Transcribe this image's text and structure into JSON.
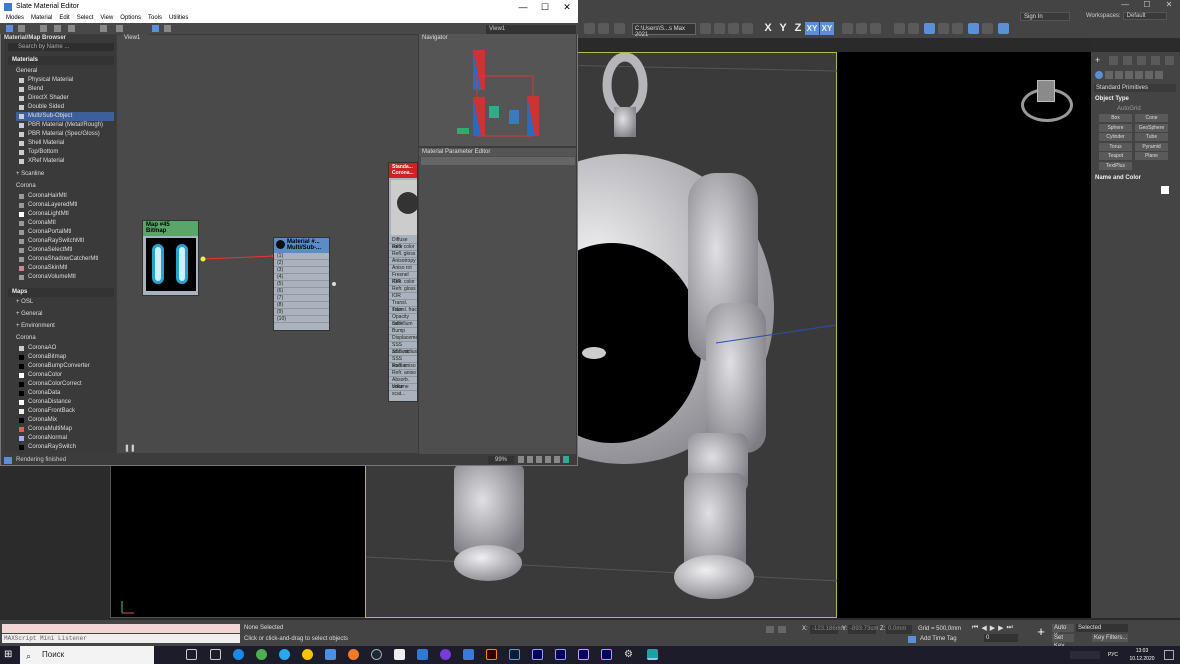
{
  "max": {
    "signin": "Sign In",
    "workspaces_label": "Workspaces:",
    "workspaces_value": "Default",
    "path": "C:\\Users\\S...s Max 2021",
    "axes": [
      "X",
      "Y",
      "Z",
      "XY",
      "XY"
    ],
    "command_panel": {
      "dropdown": "Standard Primitives",
      "object_type": "Object Type",
      "autogrid": "AutoGrid",
      "buttons": [
        "Box",
        "Cone",
        "Sphere",
        "GeoSphere",
        "Cylinder",
        "Tube",
        "Torus",
        "Pyramid",
        "Teapot",
        "Plane",
        "TextPlus"
      ],
      "name_and_color": "Name and Color"
    },
    "status": {
      "none_selected": "None Selected",
      "hint": "Click or click-and-drag to select objects",
      "x_label": "X:",
      "x_val": "-123.186mm",
      "y_label": "Y:",
      "y_val": "-893.73cm",
      "z_label": "Z:",
      "z_val": "0.0mm",
      "grid": "Grid = 500,0mm",
      "add_time_tag": "Add Time Tag",
      "auto_key": "Auto K...",
      "set_key": "Set Key",
      "selected": "Selected",
      "key_filters": "Key Filters...",
      "frame": "0"
    },
    "maxscript": "",
    "maxscript_listener": "MAXScript Mini Listener"
  },
  "slate": {
    "title": "Slate Material Editor",
    "menus": [
      "Modes",
      "Material",
      "Edit",
      "Select",
      "View",
      "Options",
      "Tools",
      "Utilities"
    ],
    "view_tab": "View1",
    "view_dropdown": "View1",
    "browser_title": "Material/Map Browser",
    "search_placeholder": "Search by Name ...",
    "sections": {
      "materials": "Materials",
      "general": "General",
      "scanline": "+ Scanline",
      "corona": "Corona",
      "maps": "Maps",
      "osl": "+ OSL",
      "maps_general": "+ General",
      "environment": "+ Environment",
      "maps_corona": "Corona"
    },
    "general_items": [
      "Physical Material",
      "Blend",
      "DirectX Shader",
      "Double Sided",
      "Multi/Sub-Object",
      "PBR Material (Metal/Rough)",
      "PBR Material (Spec/Gloss)",
      "Shell Material",
      "Top/Bottom",
      "XRef Material"
    ],
    "corona_items": [
      "CoronaHairMtl",
      "CoronaLayeredMtl",
      "CoronaLightMtl",
      "CoronaMtl",
      "CoronaPortalMtl",
      "CoronaRaySwitchMtl",
      "CoronaSelectMtl",
      "CoronaShadowCatcherMtl",
      "CoronaSkinMtl",
      "CoronaVolumeMtl"
    ],
    "map_items": [
      "CoronaAO",
      "CoronaBitmap",
      "CoronaBumpConverter",
      "CoronaColor",
      "CoronaColorCorrect",
      "CoronaData",
      "CoronaDistance",
      "CoronaFrontBack",
      "CoronaMix",
      "CoronaMultiMap",
      "CoronaNormal",
      "CoronaRaySwitch"
    ],
    "navigator": "Navigator",
    "param_editor": "Material Parameter Editor",
    "node_bitmap": {
      "line1": "Map #45",
      "line2": "Bitmap"
    },
    "node_multi": {
      "line1": "Material #...",
      "line2": "Multi/Sub-...",
      "slots": [
        "(1)",
        "(2)",
        "(3)",
        "(4)",
        "(5)",
        "(6)",
        "(7)",
        "(8)",
        "(9)",
        "(10)"
      ]
    },
    "node_corona": {
      "line1": "Standa...",
      "line2": "Corona...",
      "slots": [
        "Diffuse color",
        "Refl. color",
        "Refl. gloss",
        "Anisotropy",
        "Aniso rot",
        "Fresnel IOR",
        "Refr. color",
        "Refr. gloss",
        "IOR",
        "Transl. color",
        "Transl. frac",
        "Opacity color",
        "Self-illum",
        "Bump",
        "Displacement",
        "SSS amount",
        "SSS radius",
        "SSS scatter",
        "Refl. aniso",
        "Refr. aniso",
        "Absorb. color",
        "Volume scat..."
      ]
    },
    "status": "Rendering finished",
    "zoom": "99%"
  },
  "taskbar": {
    "search": "Поиск",
    "lang": "РУС",
    "time": "13:03",
    "date": "10.12.2020"
  }
}
